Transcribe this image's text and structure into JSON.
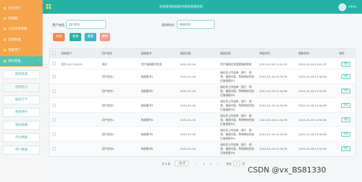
{
  "header": {
    "title": "欢迎来到校园图书借阅管理系统",
    "user": "admin"
  },
  "sidebar": {
    "items": [
      {
        "label": "后台首页"
      },
      {
        "label": "轮播图"
      },
      {
        "label": "公告消息管理"
      },
      {
        "label": "资源管理"
      },
      {
        "label": "系统用户"
      },
      {
        "label": "模块管理"
      }
    ],
    "sub_items": [
      {
        "label": "借阅资源"
      },
      {
        "label": "借阅登记"
      },
      {
        "label": "报名打卡"
      },
      {
        "label": "报修预约"
      },
      {
        "label": "我的收藏"
      },
      {
        "label": "评分数据"
      },
      {
        "label": "用户数据"
      }
    ]
  },
  "search": {
    "label1": "用户姓名",
    "placeholder1": "用户姓名",
    "label2": "借阅时间",
    "placeholder2": "借阅时间"
  },
  "buttons": {
    "add": "添加",
    "search": "查询",
    "reset": "重置",
    "delete": "删除"
  },
  "table": {
    "headers": [
      "借阅用户",
      "用户姓名",
      "借阅图书",
      "借阅日期",
      "借阅内容",
      "审核时间",
      "更新时间",
      "操作"
    ],
    "rows": [
      {
        "user": "用户123 123123",
        "name": "测试",
        "book": "用户借阅图书信息",
        "date": "2021-01-16",
        "content1": "用户借阅信息需要借阅审核",
        "content2": "",
        "content3": "",
        "audit": "2021-01-16 11:41:23",
        "updated": "2021-01-16 11:41:23",
        "action": "详情"
      },
      {
        "user": "",
        "name": "用户姓名1",
        "book": "借阅图书1",
        "date": "2021-01-16",
        "content1": "请在同上传送单、图片、视",
        "content2": "频、借阅内容，等待审核完成",
        "content3": "后借阅图书1",
        "audit": "2021-01-16 11:34:59",
        "updated": "2021-01-16 11:34:59",
        "action": "详情"
      },
      {
        "user": "",
        "name": "用户姓名2",
        "book": "借阅图书2",
        "date": "2021-01-16",
        "content1": "请在同上传送单、图片、视",
        "content2": "频、借阅内容，等待审核完成",
        "content3": "后借阅图书2",
        "audit": "2021-01-16 11:34:59",
        "updated": "2021-01-16 11:34:59",
        "action": "详情"
      },
      {
        "user": "",
        "name": "用户姓名3",
        "book": "借阅图书3",
        "date": "2021-01-16",
        "content1": "请在同上传送单、图片、视",
        "content2": "频、借阅内容，等待审核完成",
        "content3": "后借阅图书3",
        "audit": "2021-01-16 11:34:59",
        "updated": "2021-01-16 11:34:59",
        "action": "详情"
      },
      {
        "user": "",
        "name": "用户姓名4",
        "book": "借阅图书4",
        "date": "2021-01-16",
        "content1": "请在同上传送单、图片、视",
        "content2": "频、借阅内容，等待审核完成",
        "content3": "后借阅图书4",
        "audit": "2021-01-16 11:34:59",
        "updated": "2021-01-16 11:34:59",
        "action": "详情"
      },
      {
        "user": "",
        "name": "用户姓名5",
        "book": "借阅图书5",
        "date": "2021-01-16",
        "content1": "请在同上传送单、图片、视",
        "content2": "频、借阅内容，等待审核完成",
        "content3": "后借阅图书5",
        "audit": "2021-01-16 11:34:59",
        "updated": "2021-01-16 11:34:59",
        "action": "详情"
      },
      {
        "user": "",
        "name": "用户姓名6",
        "book": "借阅图书6",
        "date": "2021-01-16",
        "content1": "请在同上传送单、图片、视",
        "content2": "频、借阅内容，等待审核完成",
        "content3": "后借阅图书6",
        "audit": "2021-01-16 11:34:59",
        "updated": "2021-01-16 11:34:59",
        "action": "详情"
      }
    ]
  },
  "pagination": {
    "total": "共 8 条",
    "page_size": "7条/页",
    "prev": "‹",
    "page1": "1",
    "page2": "2",
    "next": "›",
    "goto_label": "前往",
    "goto_value": "2",
    "goto_suffix": "页"
  },
  "watermark": "CSDN @vx_BS81330",
  "colors": {
    "accent": "#22b3a6",
    "sidebar": "#f6a54c",
    "add": "#f08a4b",
    "search": "#22b3a6",
    "reset": "#3fb4c9",
    "delete": "#f59a8e"
  }
}
